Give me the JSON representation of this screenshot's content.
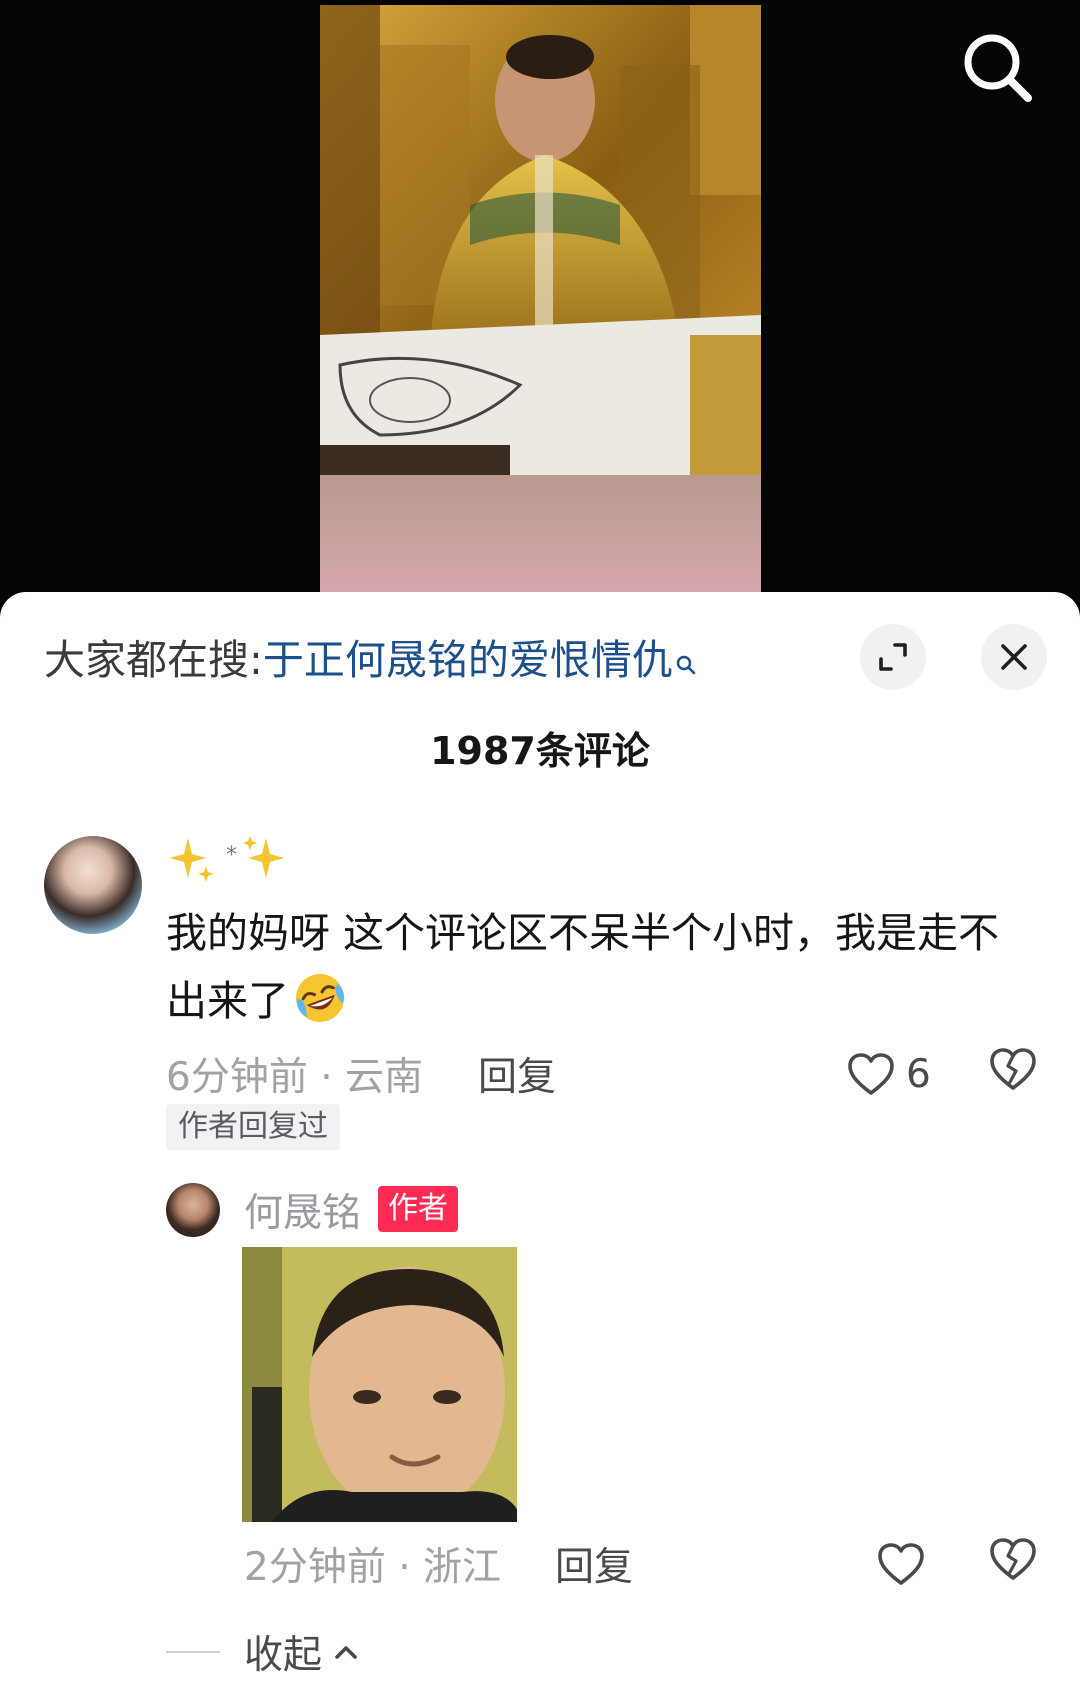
{
  "video": {
    "search_icon": "search-icon"
  },
  "sheet": {
    "hot_search_prefix": "大家都在搜:",
    "hot_search_term": "于正何晟铭的爱恨情仇",
    "expand_icon": "expand-icon",
    "close_icon": "close-icon",
    "comment_count_label": "1987条评论"
  },
  "comment": {
    "username_display": "✨*✨",
    "text": "我的妈呀 这个评论区不呆半个小时，我是走不出来了",
    "emoji": "rolling-laughing-emoji",
    "time_location": "6分钟前 · 云南",
    "reply_label": "回复",
    "like_count": "6",
    "author_replied_tag": "作者回复过"
  },
  "reply": {
    "username": "何晟铭",
    "author_badge": "作者",
    "time_location": "2分钟前 · 浙江",
    "reply_label": "回复",
    "collapse_label": "收起"
  },
  "colors": {
    "link_blue": "#1d4f8c",
    "author_badge_red": "#fe2c55",
    "meta_gray": "#a1a1a6"
  }
}
